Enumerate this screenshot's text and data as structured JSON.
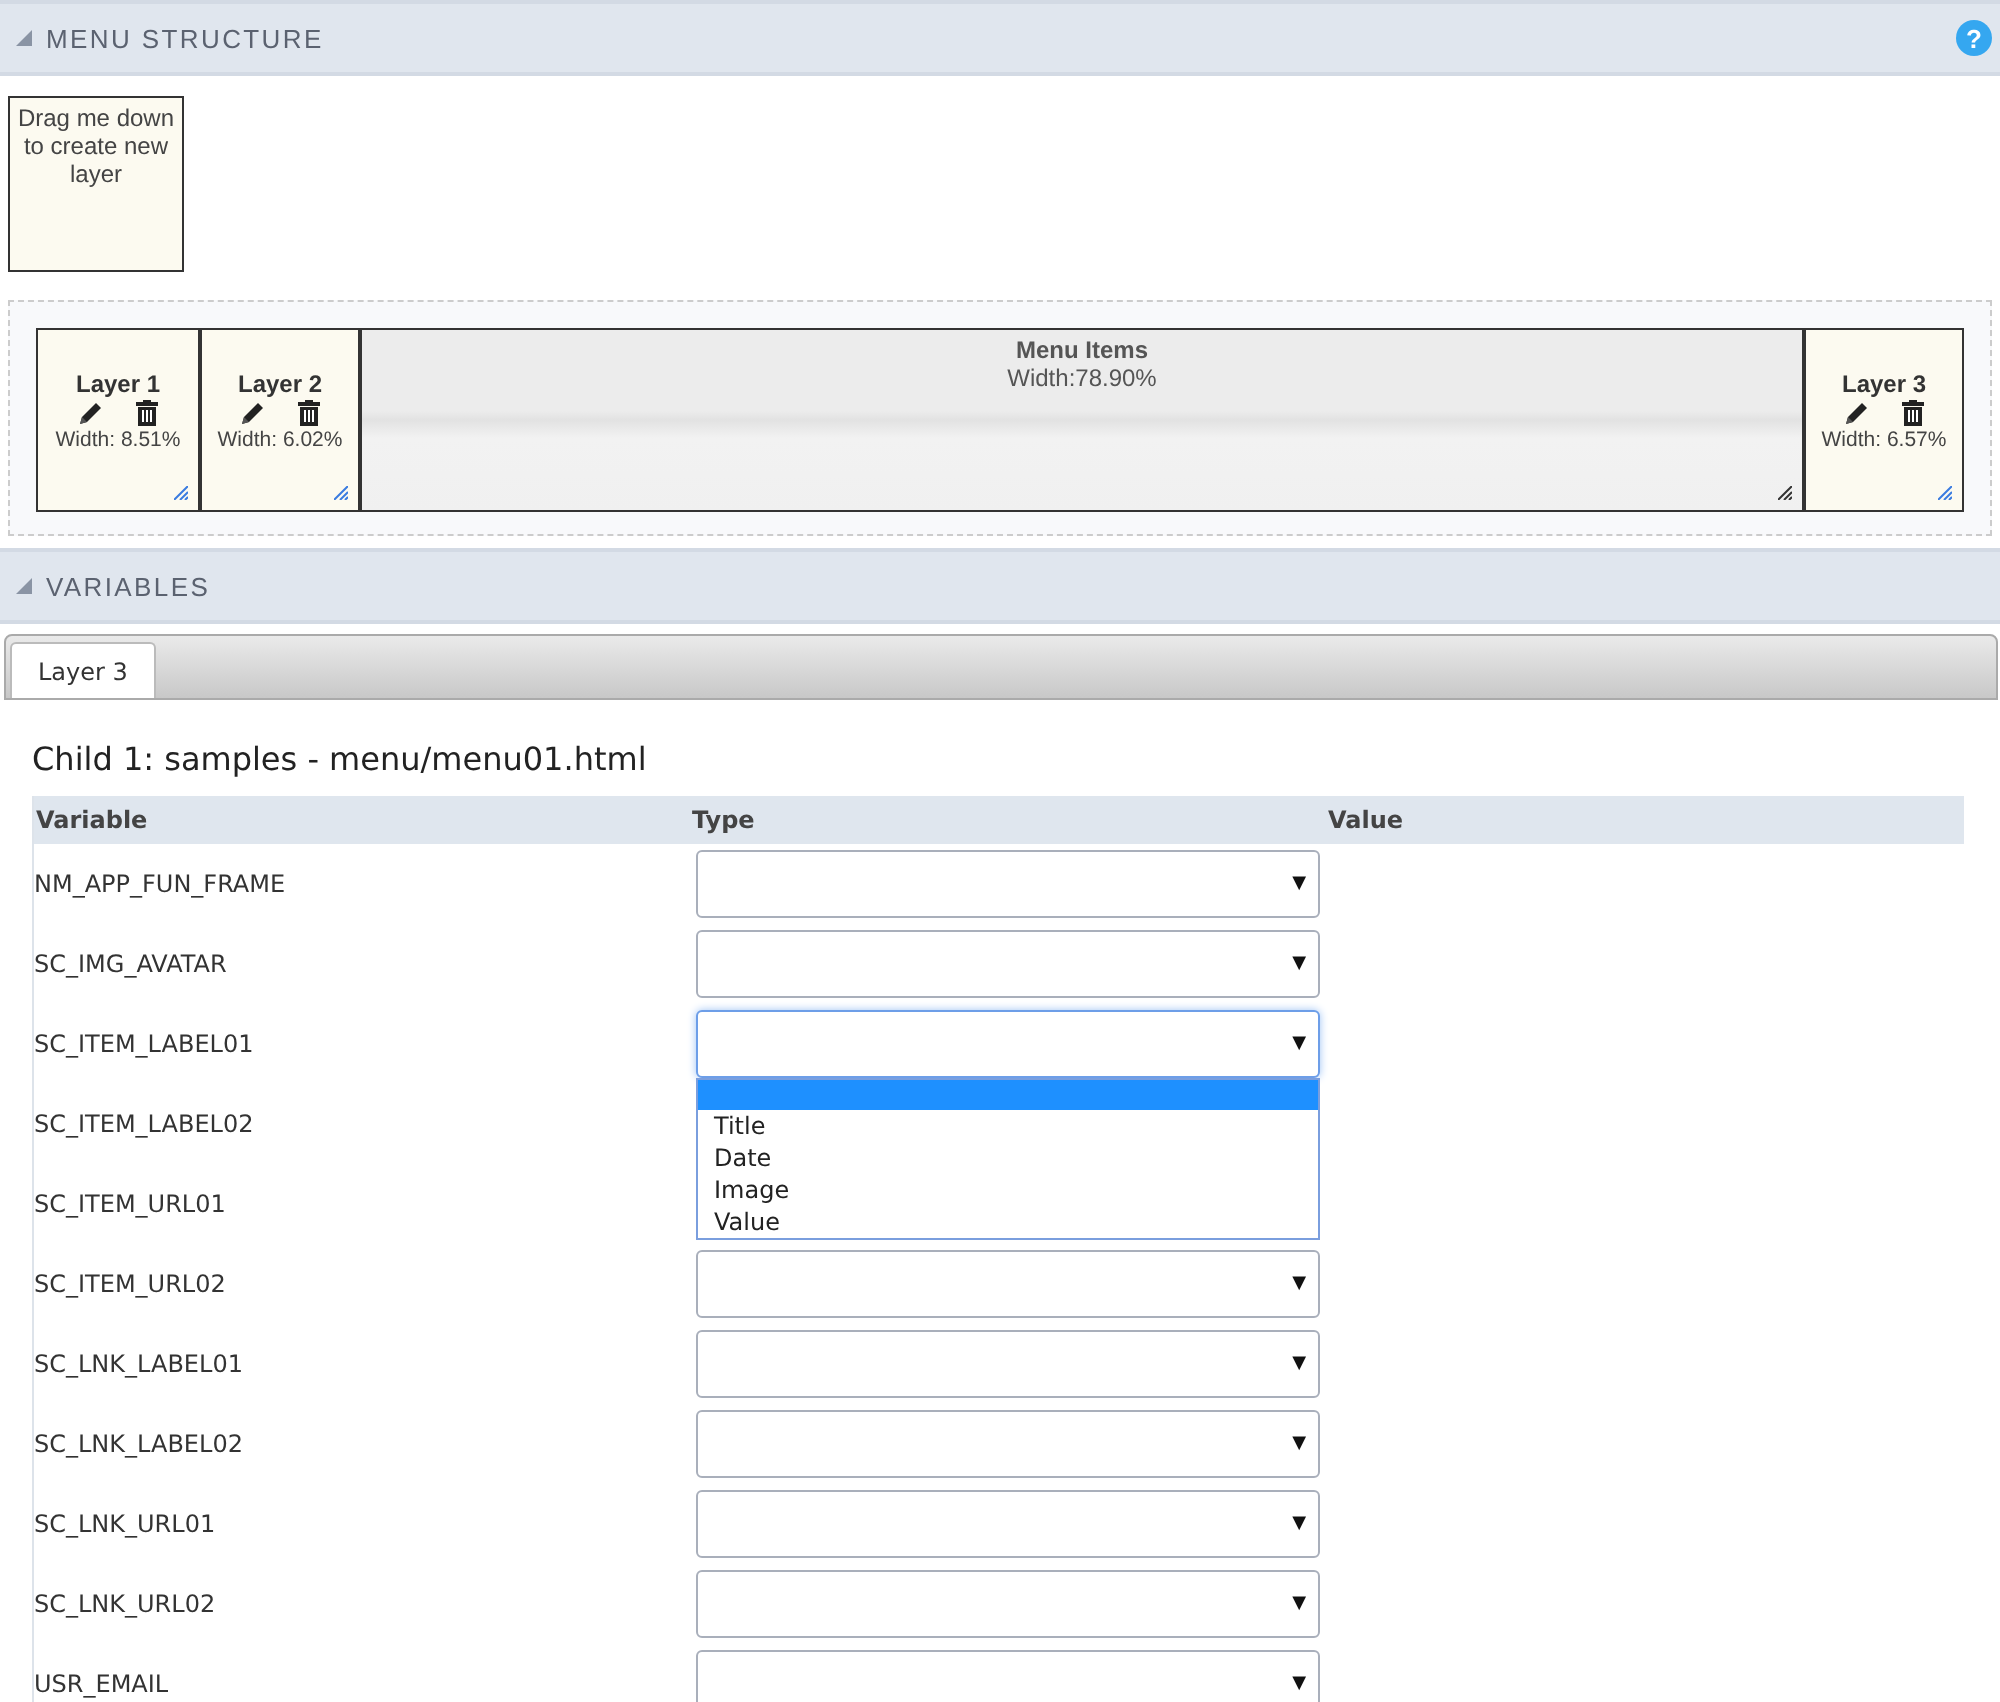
{
  "menu_structure": {
    "title": "MENU STRUCTURE",
    "help": "?",
    "drag_box": "Drag me down to create new layer",
    "layers": [
      {
        "kind": "layer",
        "name": "Layer 1",
        "width": "Width: 8.51%"
      },
      {
        "kind": "layer",
        "name": "Layer 2",
        "width": "Width: 6.02%"
      },
      {
        "kind": "items",
        "name": "Menu Items",
        "width": "Width:78.90%"
      },
      {
        "kind": "layer",
        "name": "Layer 3",
        "width": "Width: 6.57%"
      }
    ]
  },
  "variables": {
    "title": "VARIABLES",
    "tabs": [
      {
        "label": "Layer 3",
        "selected": true
      }
    ],
    "heading": "Child 1: samples - menu/menu01.html",
    "columns": [
      "Variable",
      "Type",
      "Value"
    ],
    "rows": [
      {
        "variable": "NM_APP_FUN_FRAME",
        "kind": "select"
      },
      {
        "variable": "SC_IMG_AVATAR",
        "kind": "select"
      },
      {
        "variable": "SC_ITEM_LABEL01",
        "kind": "open"
      },
      {
        "variable": "SC_ITEM_LABEL02",
        "kind": "covered"
      },
      {
        "variable": "SC_ITEM_URL01",
        "kind": "covered"
      },
      {
        "variable": "SC_ITEM_URL02",
        "kind": "select"
      },
      {
        "variable": "SC_LNK_LABEL01",
        "kind": "select"
      },
      {
        "variable": "SC_LNK_LABEL02",
        "kind": "select"
      },
      {
        "variable": "SC_LNK_URL01",
        "kind": "select"
      },
      {
        "variable": "SC_LNK_URL02",
        "kind": "select"
      },
      {
        "variable": "USR_EMAIL",
        "kind": "select"
      }
    ],
    "dropdown": {
      "caret": "▼",
      "blank_option": {
        "selected": true
      },
      "options": [
        {
          "label": "Title",
          "selected": false
        },
        {
          "label": "Date",
          "selected": false
        },
        {
          "label": "Image",
          "selected": false
        },
        {
          "label": "Value",
          "selected": false
        }
      ]
    }
  }
}
